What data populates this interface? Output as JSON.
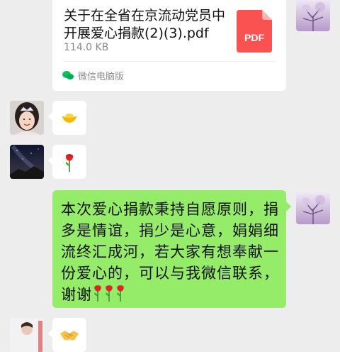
{
  "file_message": {
    "title": "关于在全省在京流动党员中开展爱心捐款(2)(3).pdf",
    "size": "114.0 KB",
    "file_type_label": "PDF",
    "source": "微信电脑版",
    "icon": "pdf-icon",
    "source_icon": "wechat-pc-icon"
  },
  "messages": [
    {
      "sender": "other",
      "content_icon": "gold-ingot-icon"
    },
    {
      "sender": "other",
      "content_icon": "rose-icon"
    },
    {
      "sender": "self",
      "text": "本次爱心捐款秉持自愿原则，捐多是情谊，捐少是心意，娟娟细流终汇成河，若大家有想奉献一份爱心的，可以与我微信联系，谢谢",
      "trailing_icons": [
        "rose-icon",
        "rose-icon",
        "rose-icon"
      ]
    },
    {
      "sender": "other",
      "content_icon": "handshake-icon"
    }
  ],
  "colors": {
    "chat_background": "#ededed",
    "self_bubble": "#95ec69",
    "other_bubble": "#ffffff",
    "pdf_red": "#fa5151"
  }
}
